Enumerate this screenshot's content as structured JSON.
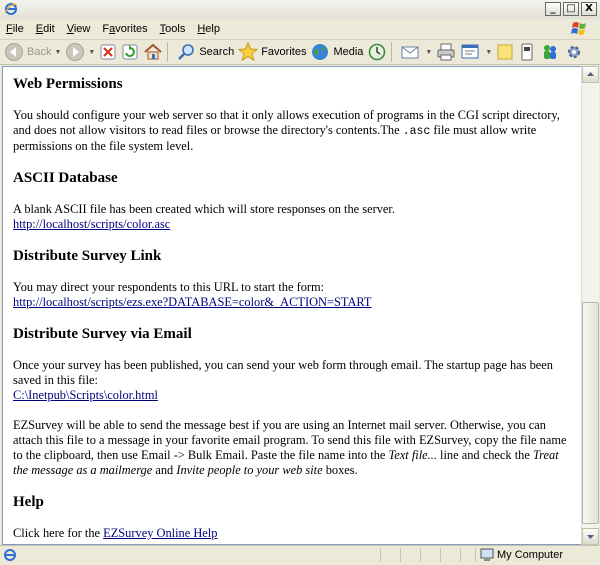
{
  "menu": {
    "items": [
      {
        "key": "F",
        "rest": "ile"
      },
      {
        "key": "E",
        "rest": "dit"
      },
      {
        "key": "V",
        "rest": "iew"
      },
      {
        "key": "",
        "rest": "Favorites",
        "pre": "F",
        "mid": "a",
        "post": "vorites"
      },
      {
        "key": "T",
        "rest": "ools"
      },
      {
        "key": "H",
        "rest": "elp"
      }
    ]
  },
  "toolbar": {
    "back_label": "Back",
    "search_label": "Search",
    "favorites_label": "Favorites",
    "media_label": "Media"
  },
  "window": {
    "minimize": "_",
    "maximize": "□",
    "close": "X"
  },
  "sections": {
    "web_permissions": {
      "heading": "Web Permissions",
      "text_before": "You should configure your web server so that it only allows execution of programs in the CGI script directory, and does not allow visitors to read files or browse the directory's contents.The ",
      "code": ".asc",
      "text_after": " file must allow write permissions on the file system level."
    },
    "ascii_database": {
      "heading": "ASCII Database",
      "text": "A blank ASCII file has been created which will store responses on the server.",
      "link": "http://localhost/scripts/color.asc"
    },
    "distribute_link": {
      "heading": "Distribute Survey Link",
      "text": "You may direct your respondents to this URL to start the form:",
      "link": "http://localhost/scripts/ezs.exe?DATABASE=color&_ACTION=START"
    },
    "distribute_email": {
      "heading": "Distribute Survey via Email",
      "text": "Once your survey has been published, you can send your web form through email. The startup page has been saved in this file:",
      "link": "C:\\Inetpub\\Scripts\\color.html",
      "para2_a": "EZSurvey will be able to send the message best if you are using an Internet mail server. Otherwise, you can attach this file to a message in your favorite email program. To send this file with EZSurvey, copy the file name to the clipboard, then use Email -> Bulk Email. Paste the file name into the ",
      "para2_i1": "Text file...",
      "para2_b": " line and check the ",
      "para2_i2": "Treat the message as a mailmerge",
      "para2_c": " and ",
      "para2_i3": "Invite people to your web site",
      "para2_d": " boxes."
    },
    "help": {
      "heading": "Help",
      "text": "Click here for the ",
      "link": "EZSurvey Online Help"
    }
  },
  "status": {
    "zone": "My Computer"
  }
}
